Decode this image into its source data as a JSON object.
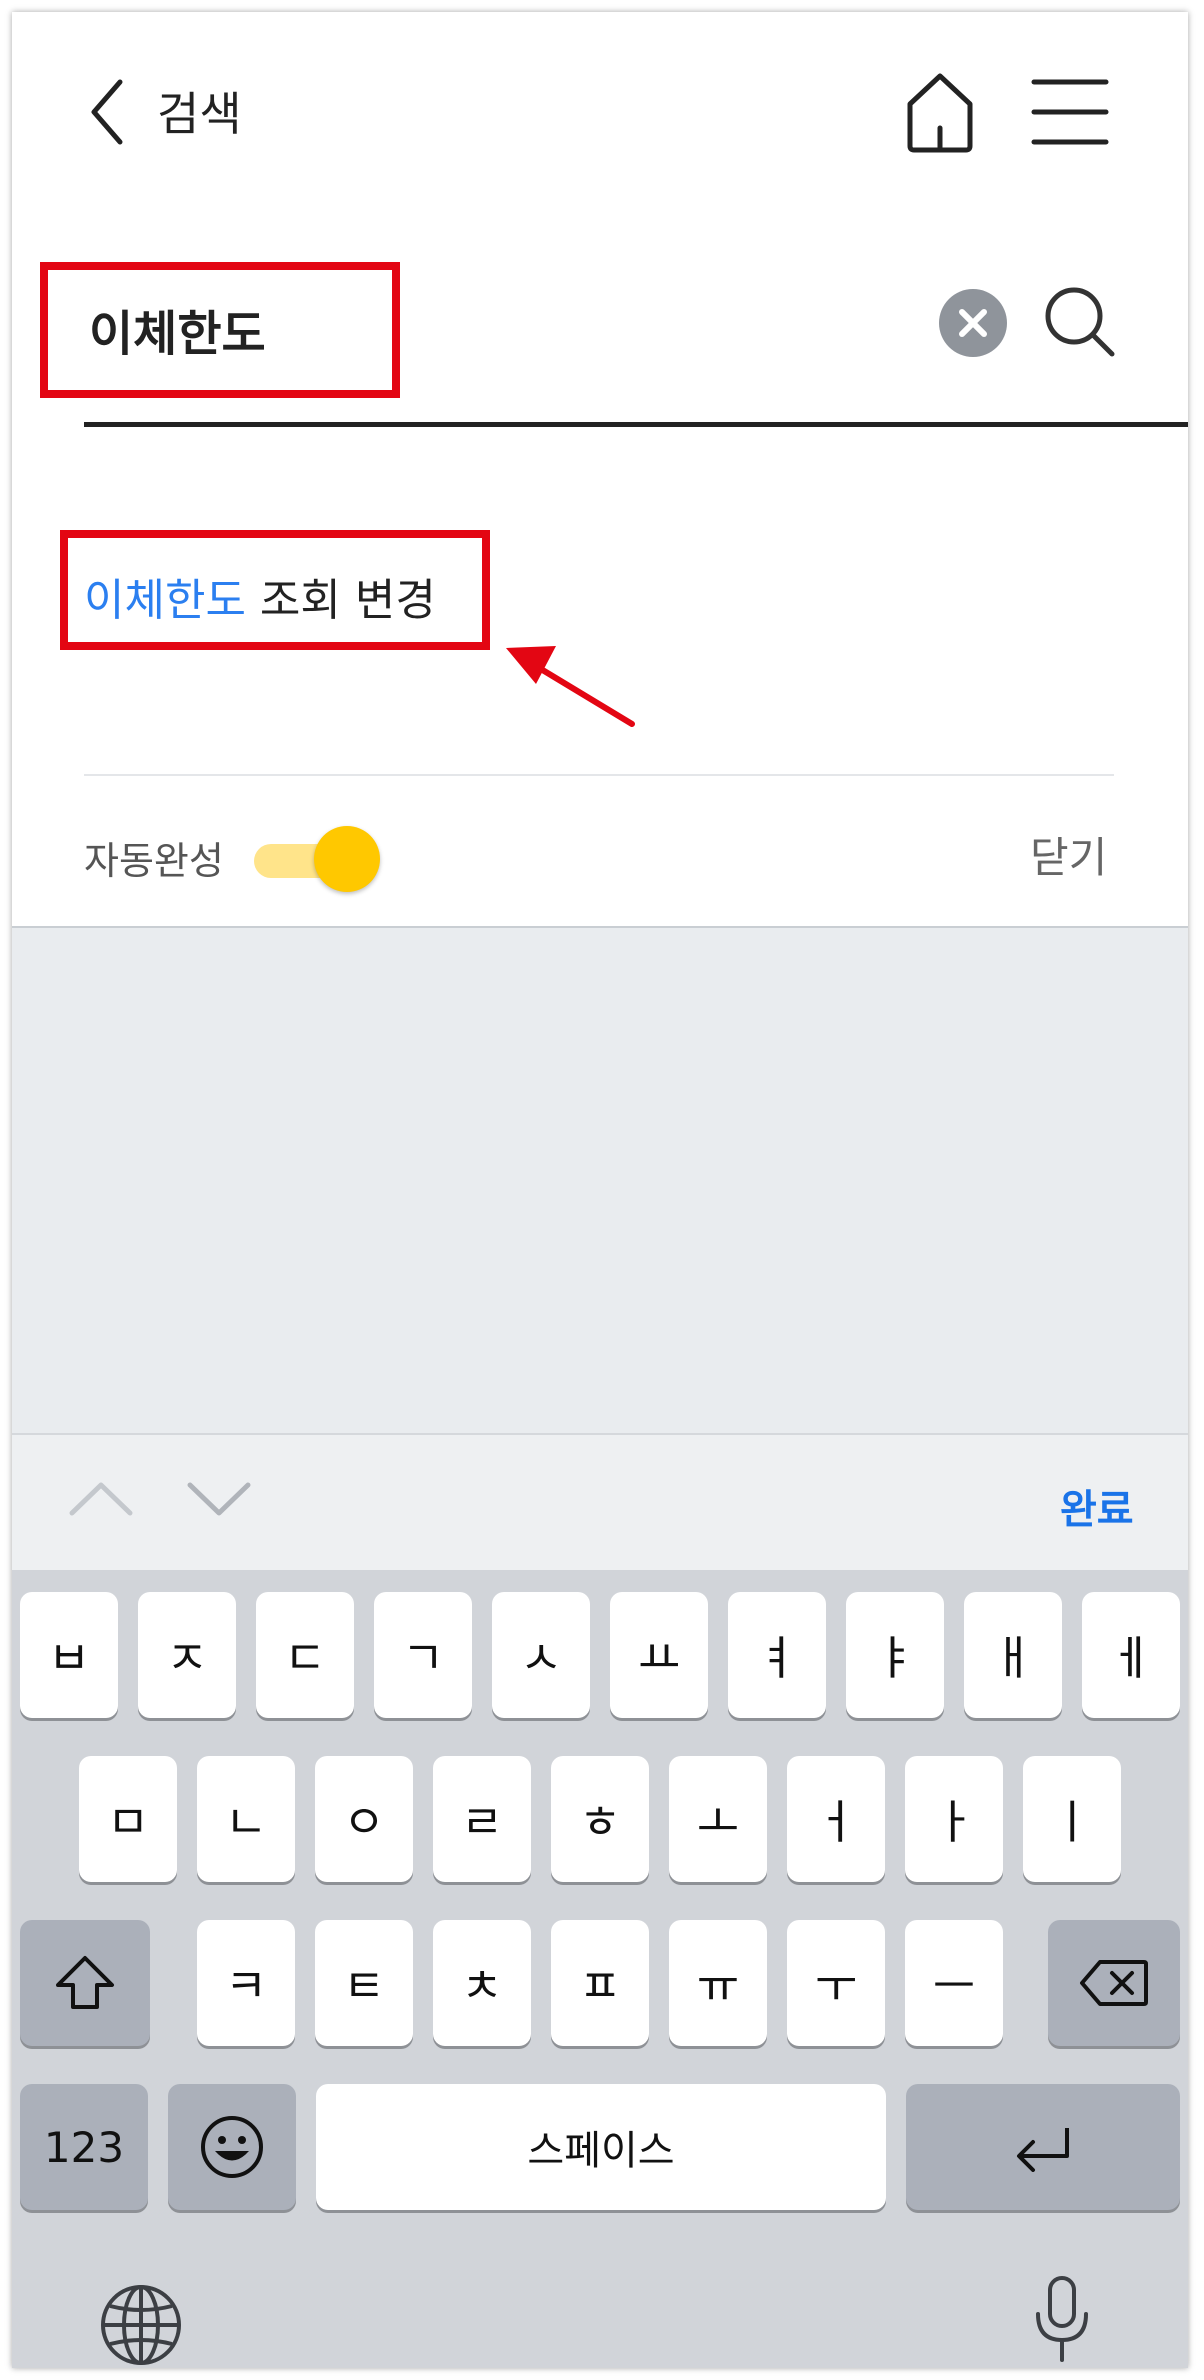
{
  "header": {
    "title": "검색",
    "back_icon": "chevron-left-icon",
    "home_icon": "home-icon",
    "menu_icon": "hamburger-menu-icon"
  },
  "search": {
    "value": "이체한도",
    "clear_icon": "clear-x-icon",
    "search_icon": "magnifier-icon"
  },
  "suggestions": [
    {
      "match": "이체한도",
      "rest": " 조회 변경"
    }
  ],
  "autocomplete": {
    "label": "자동완성",
    "enabled": true,
    "close_label": "닫기"
  },
  "accessory_bar": {
    "done_label": "완료"
  },
  "keyboard": {
    "row1": [
      "ㅂ",
      "ㅈ",
      "ㄷ",
      "ㄱ",
      "ㅅ",
      "ㅛ",
      "ㅕ",
      "ㅑ",
      "ㅐ",
      "ㅔ"
    ],
    "row2": [
      "ㅁ",
      "ㄴ",
      "ㅇ",
      "ㄹ",
      "ㅎ",
      "ㅗ",
      "ㅓ",
      "ㅏ",
      "ㅣ"
    ],
    "row3": [
      "ㅋ",
      "ㅌ",
      "ㅊ",
      "ㅍ",
      "ㅠ",
      "ㅜ",
      "ㅡ"
    ],
    "numbers_label": "123",
    "space_label": "스페이스"
  },
  "colors": {
    "highlight_red": "#e30613",
    "match_blue": "#2b7ff0",
    "toggle_yellow": "#ffc800",
    "done_blue": "#1a73e8"
  }
}
